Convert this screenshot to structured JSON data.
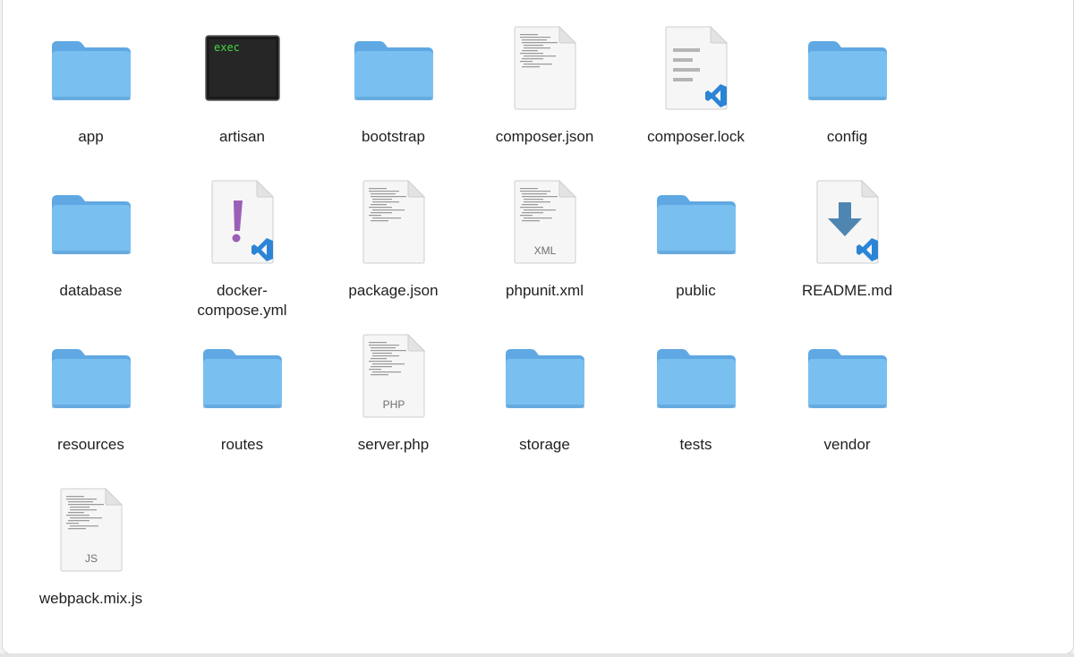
{
  "window": {
    "view": "icons",
    "items": [
      {
        "name": "app",
        "kind": "folder"
      },
      {
        "name": "artisan",
        "kind": "exec",
        "badge": "exec"
      },
      {
        "name": "bootstrap",
        "kind": "folder"
      },
      {
        "name": "composer.json",
        "kind": "text-doc"
      },
      {
        "name": "composer.lock",
        "kind": "vscode-doc"
      },
      {
        "name": "config",
        "kind": "folder"
      },
      {
        "name": "database",
        "kind": "folder"
      },
      {
        "name": "docker-compose.yml",
        "kind": "yaml-vscode",
        "display": "docker-\ncompose.yml"
      },
      {
        "name": "package.json",
        "kind": "text-doc"
      },
      {
        "name": "phpunit.xml",
        "kind": "typed-doc",
        "badge": "XML"
      },
      {
        "name": "public",
        "kind": "folder"
      },
      {
        "name": "README.md",
        "kind": "markdown-vscode"
      },
      {
        "name": "resources",
        "kind": "folder"
      },
      {
        "name": "routes",
        "kind": "folder"
      },
      {
        "name": "server.php",
        "kind": "typed-doc",
        "badge": "PHP"
      },
      {
        "name": "storage",
        "kind": "folder"
      },
      {
        "name": "tests",
        "kind": "folder"
      },
      {
        "name": "vendor",
        "kind": "folder"
      },
      {
        "name": "webpack.mix.js",
        "kind": "typed-doc",
        "badge": "JS"
      }
    ]
  },
  "colors": {
    "folder_front": "#79c0f1",
    "folder_back": "#5fa8e3",
    "folder_shadow": "#5a9dd6",
    "vscode_blue": "#2c84d6",
    "yaml_purple": "#9b5fb8",
    "markdown_arrow": "#4f86b1"
  }
}
